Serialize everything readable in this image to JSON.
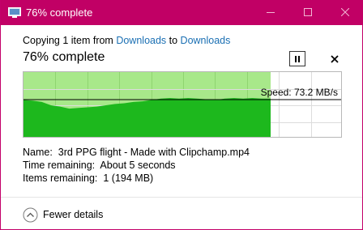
{
  "window": {
    "title": "76% complete",
    "accent_color": "#c10065"
  },
  "copy": {
    "prefix": "Copying 1 item from ",
    "source": "Downloads",
    "middle": " to ",
    "destination": "Downloads",
    "heading": "76% complete",
    "progress_percent": 76
  },
  "controls": {
    "pause_icon": "pause-icon",
    "cancel_icon": "close-icon"
  },
  "graph": {
    "speed_label": "Speed: 73.2 MB/s",
    "fill_color": "#1db81d",
    "completed_bg_color": "#a8e88a"
  },
  "details": {
    "name_label": "Name:",
    "name_value": "3rd PPG flight - Made with Clipchamp.mp4",
    "time_label": "Time remaining:",
    "time_value": "About 5 seconds",
    "items_label": "Items remaining:",
    "items_value": "1 (194 MB)"
  },
  "footer": {
    "fewer_details": "Fewer details"
  }
}
